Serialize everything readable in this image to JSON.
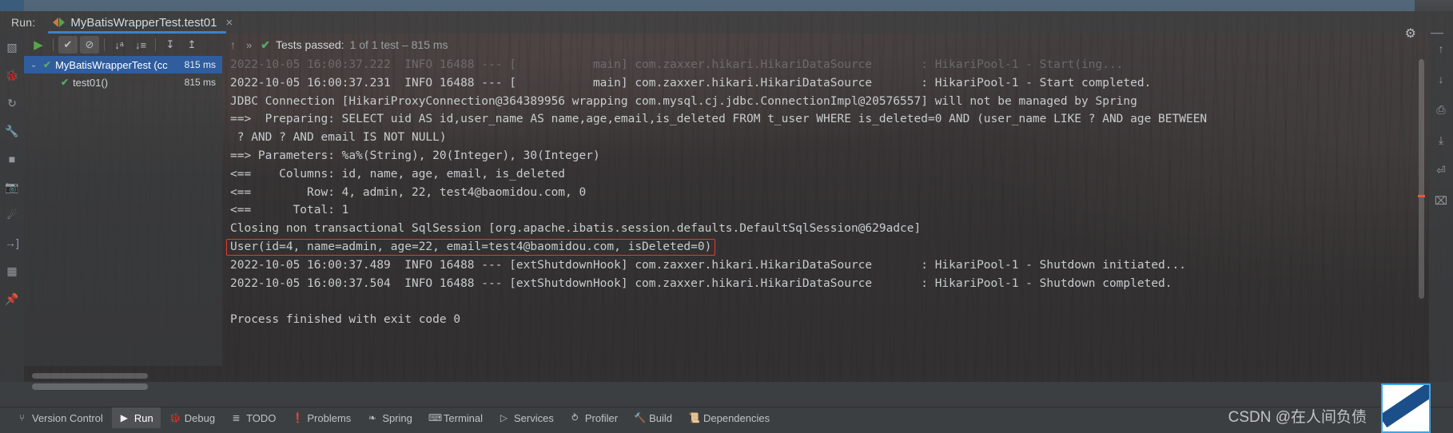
{
  "window": {
    "run_label": "Run:",
    "tab_title": "MyBatisWrapperTest.test01",
    "close_label": "×",
    "settings_icon": "⚙",
    "minimize_icon": "—"
  },
  "left_rail": [
    {
      "name": "project-icon",
      "glyph": "▧"
    },
    {
      "name": "debug-icon",
      "glyph": "🐞"
    },
    {
      "name": "restart-icon",
      "glyph": "↻"
    },
    {
      "name": "wrench-icon",
      "glyph": "🔧"
    },
    {
      "name": "stop-icon",
      "glyph": "■"
    },
    {
      "name": "camera-icon",
      "glyph": "📷"
    },
    {
      "name": "filter-icon",
      "glyph": "☄"
    },
    {
      "name": "import-icon",
      "glyph": "→]"
    },
    {
      "name": "layout-icon",
      "glyph": "▦"
    },
    {
      "name": "pin-icon",
      "glyph": "📌"
    }
  ],
  "right_rail": [
    {
      "name": "scroll-up-icon",
      "glyph": "↑"
    },
    {
      "name": "scroll-down-icon",
      "glyph": "↓"
    },
    {
      "name": "print-icon",
      "glyph": "⎙"
    },
    {
      "name": "export-icon",
      "glyph": "⤓"
    },
    {
      "name": "wrap-icon",
      "glyph": "⏎"
    },
    {
      "name": "clear-icon",
      "glyph": "⌧"
    }
  ],
  "toolbar": {
    "buttons": [
      {
        "name": "rerun-tests-button",
        "glyph": "▶",
        "style": "play",
        "active": false
      },
      {
        "name": "show-passed-button",
        "glyph": "✔",
        "style": "",
        "active": true
      },
      {
        "name": "show-ignored-button",
        "glyph": "⊘",
        "style": "",
        "active": true
      },
      {
        "name": "sort-alphabetically-button",
        "glyph": "↓ᵃ",
        "style": "",
        "active": false
      },
      {
        "name": "sort-by-duration-button",
        "glyph": "↓≡",
        "style": "",
        "active": false
      },
      {
        "name": "expand-all-button",
        "glyph": "↧",
        "style": "",
        "active": false
      },
      {
        "name": "collapse-all-button",
        "glyph": "↥",
        "style": "",
        "active": false
      }
    ]
  },
  "status": {
    "up_arrow": "↑",
    "chevrons": "»",
    "check": "✔",
    "passed_text": "Tests passed:",
    "detail_text": "1 of 1 test – 815 ms"
  },
  "test_tree": {
    "rows": [
      {
        "name": "test-suite-row",
        "caret": "⌄",
        "tick": "✔",
        "label": "MyBatisWrapperTest (cc",
        "duration": "815 ms",
        "selected": true,
        "child": false
      },
      {
        "name": "test-case-row",
        "caret": "",
        "tick": "✔",
        "label": "test01()",
        "duration": "815 ms",
        "selected": false,
        "child": true
      }
    ]
  },
  "console": {
    "lines": [
      {
        "text": "2022-10-05 16:00:37.222  INFO 16488 --- [           main] com.zaxxer.hikari.HikariDataSource       : HikariPool-1 - Start(ing...",
        "clipped": true,
        "highlight": false
      },
      {
        "text": "2022-10-05 16:00:37.231  INFO 16488 --- [           main] com.zaxxer.hikari.HikariDataSource       : HikariPool-1 - Start completed.",
        "clipped": false,
        "highlight": false
      },
      {
        "text": "JDBC Connection [HikariProxyConnection@364389956 wrapping com.mysql.cj.jdbc.ConnectionImpl@20576557] will not be managed by Spring",
        "clipped": false,
        "highlight": false
      },
      {
        "text": "==>  Preparing: SELECT uid AS id,user_name AS name,age,email,is_deleted FROM t_user WHERE is_deleted=0 AND (user_name LIKE ? AND age BETWEEN",
        "clipped": false,
        "highlight": false
      },
      {
        "text": " ? AND ? AND email IS NOT NULL)",
        "clipped": false,
        "highlight": false
      },
      {
        "text": "==> Parameters: %a%(String), 20(Integer), 30(Integer)",
        "clipped": false,
        "highlight": false
      },
      {
        "text": "<==    Columns: id, name, age, email, is_deleted",
        "clipped": false,
        "highlight": false
      },
      {
        "text": "<==        Row: 4, admin, 22, test4@baomidou.com, 0",
        "clipped": false,
        "highlight": false
      },
      {
        "text": "<==      Total: 1",
        "clipped": false,
        "highlight": false
      },
      {
        "text": "Closing non transactional SqlSession [org.apache.ibatis.session.defaults.DefaultSqlSession@629adce]",
        "clipped": false,
        "highlight": false
      },
      {
        "text": "User(id=4, name=admin, age=22, email=test4@baomidou.com, isDeleted=0)",
        "clipped": false,
        "highlight": true
      },
      {
        "text": "2022-10-05 16:00:37.489  INFO 16488 --- [extShutdownHook] com.zaxxer.hikari.HikariDataSource       : HikariPool-1 - Shutdown initiated...",
        "clipped": false,
        "highlight": false
      },
      {
        "text": "2022-10-05 16:00:37.504  INFO 16488 --- [extShutdownHook] com.zaxxer.hikari.HikariDataSource       : HikariPool-1 - Shutdown completed.",
        "clipped": false,
        "highlight": false
      },
      {
        "text": "",
        "clipped": false,
        "highlight": false
      },
      {
        "text": "Process finished with exit code 0",
        "clipped": false,
        "highlight": false
      }
    ],
    "highlight_color": "#e33b2e"
  },
  "bottom_tabs": [
    {
      "name": "bottom-tab-version-control",
      "icon": "⑂",
      "label": "Version Control",
      "active": false
    },
    {
      "name": "bottom-tab-run",
      "icon": "▶",
      "label": "Run",
      "active": true
    },
    {
      "name": "bottom-tab-debug",
      "icon": "🐞",
      "label": "Debug",
      "active": false
    },
    {
      "name": "bottom-tab-todo",
      "icon": "≣",
      "label": "TODO",
      "active": false
    },
    {
      "name": "bottom-tab-problems",
      "icon": "❗",
      "label": "Problems",
      "active": false
    },
    {
      "name": "bottom-tab-spring",
      "icon": "❧",
      "label": "Spring",
      "active": false
    },
    {
      "name": "bottom-tab-terminal",
      "icon": "⌨",
      "label": "Terminal",
      "active": false
    },
    {
      "name": "bottom-tab-services",
      "icon": "▷",
      "label": "Services",
      "active": false
    },
    {
      "name": "bottom-tab-profiler",
      "icon": "⥁",
      "label": "Profiler",
      "active": false
    },
    {
      "name": "bottom-tab-build",
      "icon": "🔨",
      "label": "Build",
      "active": false
    },
    {
      "name": "bottom-tab-dependencies",
      "icon": "📜",
      "label": "Dependencies",
      "active": false
    }
  ],
  "watermark": {
    "text": "CSDN @在人间负债"
  }
}
